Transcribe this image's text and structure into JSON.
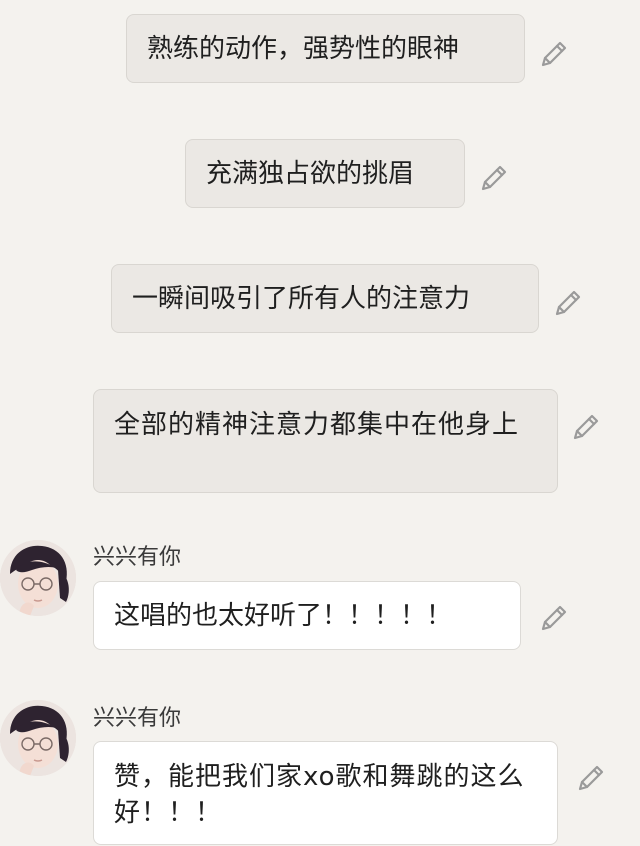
{
  "messages": {
    "m1": {
      "text": "熟练的动作，强势性的眼神"
    },
    "m2": {
      "text": "充满独占欲的挑眉"
    },
    "m3": {
      "text": "一瞬间吸引了所有人的注意力"
    },
    "m4": {
      "text": "全部的精神注意力都集中在他身上"
    },
    "m5": {
      "sender": "兴兴有你",
      "text": "这唱的也太好听了！！！！！"
    },
    "m6": {
      "sender": "兴兴有你",
      "text": "赞，能把我们家xo歌和舞跳的这么好！！！"
    }
  },
  "icons": {
    "edit": "pencil-icon",
    "avatar": "user-avatar"
  },
  "colors": {
    "background": "#f4f2ee",
    "gray_bubble": "#ebe8e4",
    "white_bubble": "#ffffff",
    "icon": "#9a9a9a"
  }
}
